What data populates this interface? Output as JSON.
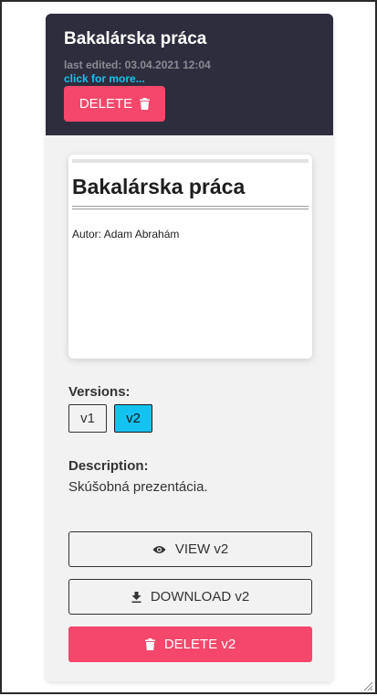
{
  "header": {
    "title": "Bakalárska práca",
    "last_edited": "last edited: 03.04.2021 12:04",
    "more_link": "click for more...",
    "delete_label": "DELETE"
  },
  "preview": {
    "doc_title": "Bakalárska práca",
    "author": "Autor: Adam Abrahám"
  },
  "versions": {
    "label": "Versions:",
    "items": [
      {
        "label": "v1",
        "active": false
      },
      {
        "label": "v2",
        "active": true
      }
    ]
  },
  "description": {
    "label": "Description:",
    "text": "Skúšobná prezentácia."
  },
  "actions": {
    "view_label": "VIEW v2",
    "download_label": "DOWNLOAD v2",
    "delete_label": "DELETE v2"
  },
  "colors": {
    "header_bg": "#2e2d3e",
    "danger": "#f4476b",
    "accent": "#14c2f0"
  },
  "icons": {
    "delete": "trash-icon",
    "view": "eye-icon",
    "download": "download-icon"
  }
}
